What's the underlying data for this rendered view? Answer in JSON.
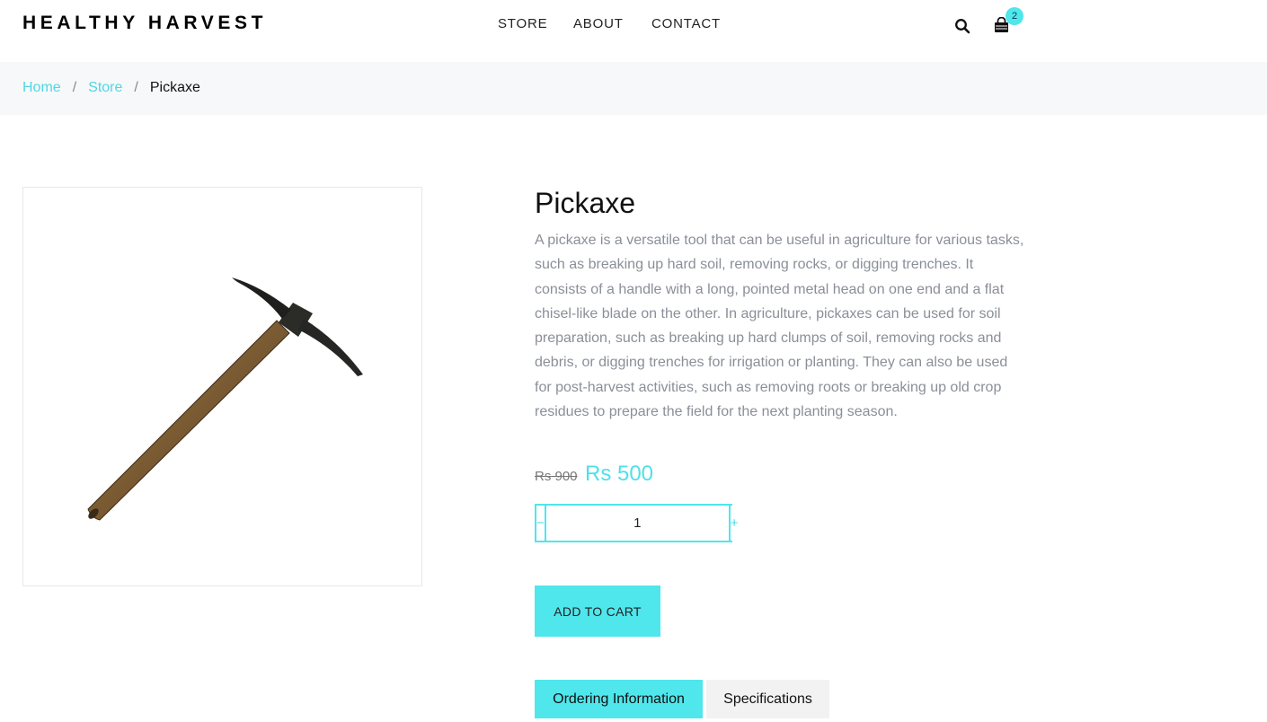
{
  "brand": {
    "name": "HEALTHY HARVEST"
  },
  "nav": {
    "items": [
      {
        "label": "STORE"
      },
      {
        "label": "ABOUT"
      },
      {
        "label": "CONTACT"
      }
    ]
  },
  "header": {
    "search_icon": "search-icon",
    "cart_icon": "shopping-bag-icon",
    "cart_count": "2"
  },
  "breadcrumb": {
    "items": [
      {
        "label": "Home"
      },
      {
        "label": "Store"
      },
      {
        "label": "Pickaxe"
      }
    ],
    "separator": "/"
  },
  "product": {
    "title": "Pickaxe",
    "description": "A pickaxe is a versatile tool that can be useful in agriculture for various tasks, such as breaking up hard soil, removing rocks, or digging trenches. It consists of a handle with a long, pointed metal head on one end and a flat chisel-like blade on the other. In agriculture, pickaxes can be used for soil preparation, such as breaking up hard clumps of soil, removing rocks and debris, or digging trenches for irrigation or planting. They can also be used for post-harvest activities, such as removing roots or breaking up old crop residues to prepare the field for the next planting season.",
    "price_old": "Rs 900",
    "price_new": "Rs 500",
    "quantity": "1",
    "qty_minus": "−",
    "qty_plus": "+",
    "add_to_cart": "ADD TO CART"
  },
  "tabs": [
    {
      "label": "Ordering Information",
      "active": true
    },
    {
      "label": "Specifications",
      "active": false
    }
  ],
  "colors": {
    "accent": "#4fe6ec",
    "link": "#4fd8e4",
    "description_text": "#8a8f98",
    "breadcrumb_bg": "#f7f8f9"
  }
}
